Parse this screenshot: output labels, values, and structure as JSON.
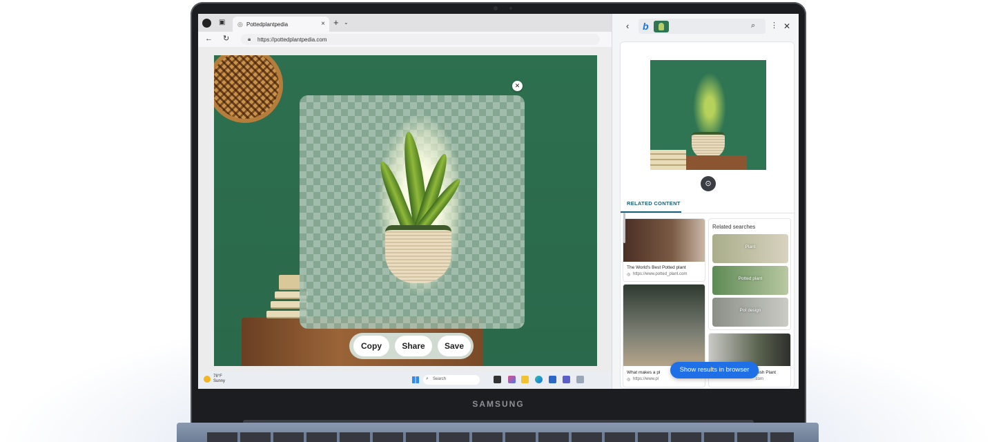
{
  "device": {
    "brand": "SAMSUNG"
  },
  "browser": {
    "tab_title": "Pottedplantpedia",
    "url": "https://pottedplantpedia.com"
  },
  "cutout_actions": {
    "copy": "Copy",
    "share": "Share",
    "save": "Save"
  },
  "taskbar": {
    "weather_temp": "78°F",
    "weather_condition": "Sunny",
    "search_placeholder": "Search"
  },
  "side_panel": {
    "tab_label": "RELATED CONTENT",
    "related_searches_title": "Related searches",
    "results": [
      {
        "title": "The World's Best Potted plant",
        "url": "https://www.potted_plant.com"
      },
      {
        "title": "What makes a pl",
        "url": "https://www.pl"
      },
      {
        "title": "esh Plant",
        "url": ".com"
      }
    ],
    "related_searches": [
      "Plant",
      "Potted plant",
      "Pot design"
    ],
    "show_results_button": "Show results in browser"
  },
  "colors": {
    "accent_blue": "#1f6fe6",
    "tab_accent": "#17607a",
    "wall_green": "#2f7553"
  },
  "icons": [
    "back-arrow-icon",
    "refresh-icon",
    "lock-icon",
    "close-icon",
    "plus-icon",
    "chevron-down-icon",
    "search-icon",
    "more-options-icon",
    "visual-search-icon",
    "globe-icon",
    "windows-icon",
    "bing-logo-icon"
  ]
}
